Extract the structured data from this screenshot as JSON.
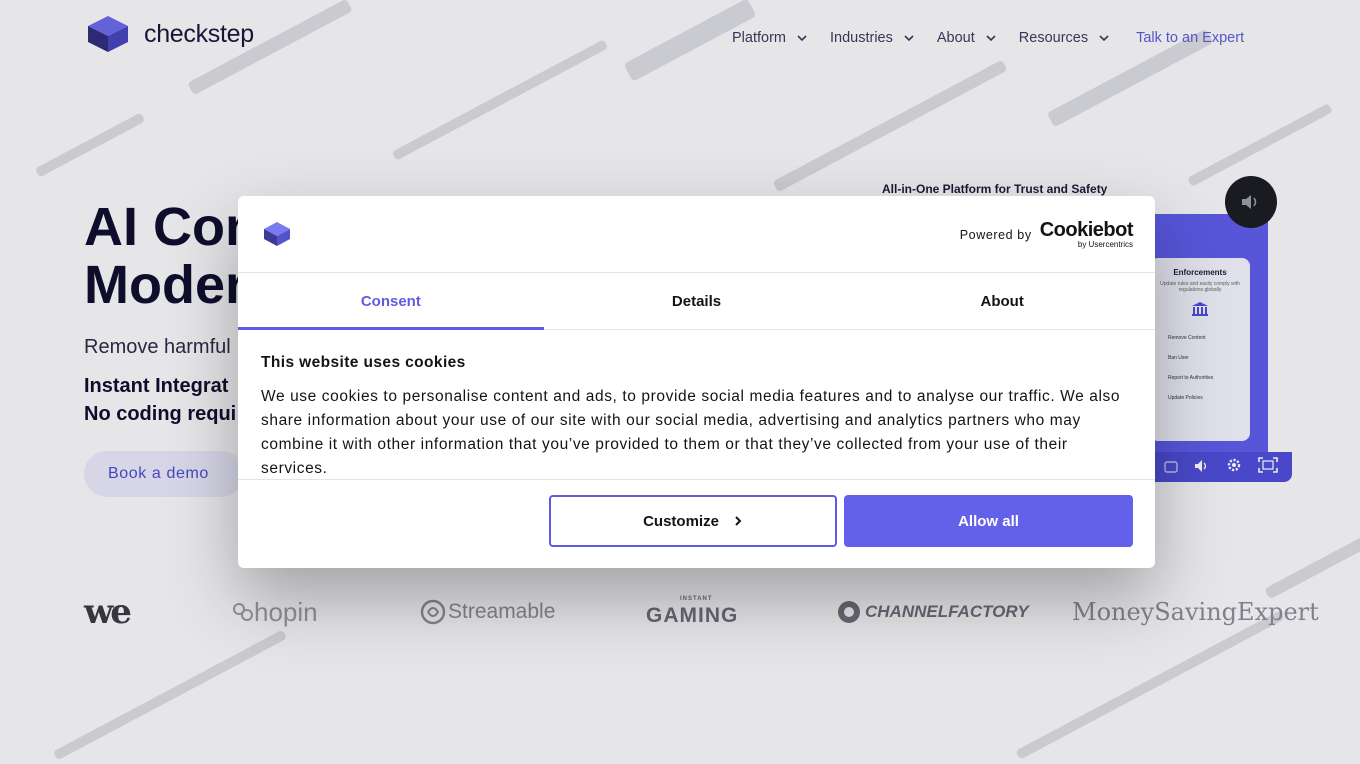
{
  "header": {
    "brand": "checkstep",
    "nav": [
      {
        "label": "Platform"
      },
      {
        "label": "Industries"
      },
      {
        "label": "About"
      },
      {
        "label": "Resources"
      }
    ],
    "cta": "Talk to an Expert"
  },
  "hero": {
    "title_line1": "AI Con",
    "title_line2": "Moder",
    "subtitle": "Remove harmful",
    "point1": "Instant Integrat",
    "point2": "No coding requi",
    "demo_button": "Book a demo"
  },
  "video": {
    "caption": "All-in-One Platform for Trust and Safety",
    "card_title": "Enforcements",
    "card_line": "Update rules and easily comply with regulations globally",
    "card_rows": [
      "Remove Content",
      "Ban User",
      "Report to Authorities",
      "Update Policies"
    ]
  },
  "client_logos": [
    "we",
    "hopin",
    "Streamable",
    "GAMING",
    "INSTANT",
    "CHANNELFACTORY",
    "MoneySavingExpert"
  ],
  "dialog": {
    "powered_by": "Powered by",
    "cookiebot_name": "Cookiebot",
    "cookiebot_by": "by Usercentrics",
    "tabs": [
      {
        "label": "Consent",
        "active": true
      },
      {
        "label": "Details",
        "active": false
      },
      {
        "label": "About",
        "active": false
      }
    ],
    "heading": "This website uses cookies",
    "text": "We use cookies to personalise content and ads, to provide social media features and to analyse our traffic. We also share information about your use of our site with our social media, advertising and analytics partners who may combine it with other information that you’ve provided to them or that they’ve collected from your use of their services.",
    "customize_label": "Customize",
    "allow_all_label": "Allow all"
  },
  "colors": {
    "accent": "#5f5ce3",
    "brand_dark": "#17173a",
    "nav_cta": "#5b5bd6"
  }
}
